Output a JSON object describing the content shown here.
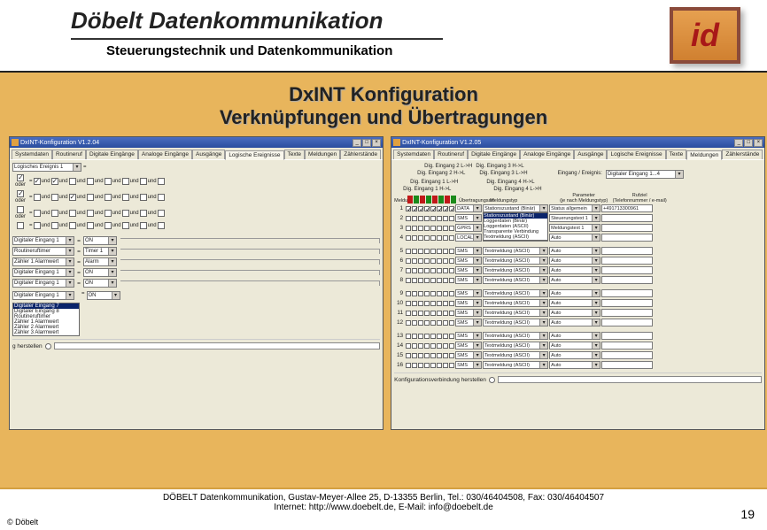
{
  "header": {
    "title": "Döbelt Datenkommunikation",
    "subtitle": "Steuerungstechnik und Datenkommunikation",
    "logo_text": "id"
  },
  "slide": {
    "line1": "DxINT Konfiguration",
    "line2": "Verknüpfungen und Übertragungen"
  },
  "win_left": {
    "title": "DxINT-Konfiguration V1.2.04",
    "tabs": [
      "Systemdaten",
      "Routineruf",
      "Digitale Eingänge",
      "Analoge Eingänge",
      "Ausgänge",
      "Logische Ereignisse",
      "Texte",
      "Meldungen",
      "Zählerstände"
    ],
    "active_tab": 5,
    "event_dd": "Logisches Ereignis 1",
    "und": "und",
    "oder": "oder",
    "eq": "=",
    "input_rows": [
      {
        "a": "Digitaler Eingang 1",
        "b": "ON"
      },
      {
        "a": "Routineruftimer",
        "b": "Timer 1"
      },
      {
        "a": "Zähler 1 Alarmwert",
        "b": "Alarm"
      },
      {
        "a": "Digitaler Eingang 1",
        "b": "ON"
      },
      {
        "a": "Digitaler Eingang 1",
        "b": "ON"
      }
    ],
    "extra_dd": "Digitaler Eingang 1",
    "listbox": [
      "Digitaler Eingang 7",
      "Digitaler Eingang 8",
      "Routineruftimer",
      "Zähler 1 Alarmwert",
      "Zähler 2 Alarmwert",
      "Zähler 3 Alarmwert"
    ],
    "last_dd": "ON",
    "status_label": "g herstellen"
  },
  "win_right": {
    "title": "DxINT-Konfiguration V1.2.05",
    "tabs": [
      "Systemdaten",
      "Routineruf",
      "Digitale Eingänge",
      "Analoge Eingänge",
      "Ausgänge",
      "Logische Ereignisse",
      "Texte",
      "Meldungen",
      "Zählerstände"
    ],
    "active_tab": 7,
    "hdr": {
      "l1a": "Dig. Eingang 2 L->H",
      "l1b": "Dig. Eingang 3 H->L",
      "l2a": "Dig. Eingang 2 H->L",
      "l2b": "Dig. Eingang 3 L->H",
      "l2c": "Eingang / Ereignis:",
      "l2d": "Digitaler Eingang 1...4",
      "l3a": "Dig. Eingang 1 L->H",
      "l3b": "Dig. Eingang 4 H->L",
      "l4a": "Dig. Eingang 1 H->L",
      "l4b": "Dig. Eingang 4 L->H"
    },
    "cols": {
      "meldung": "Meldung",
      "uart": "Übertragungsart",
      "mtyp": "Meldungstyp",
      "param": "Parameter\n(je nach Meldungstyp)",
      "rziel": "Rufziel\n(Telefonnummer / e-mail)"
    },
    "mtyp_list": [
      "Stationszustand (Binär)",
      "Loggerdaten (Binär)",
      "Loggerdaten (ASCII)",
      "Transparente Verbindung",
      "Textmeldung (ASCII)"
    ],
    "rows": [
      {
        "n": 1,
        "u": "DATA",
        "m": "Stationszustand (Binär)",
        "p": "Status allgemein",
        "r": "+491713300961",
        "chk": [
          1,
          1,
          1,
          1,
          1,
          1,
          1,
          1
        ]
      },
      {
        "n": 2,
        "u": "SMS",
        "m": "Loggerdaten (Binär)",
        "p": "Steuerungstext 1",
        "r": "",
        "chk": [
          0,
          0,
          0,
          0,
          0,
          0,
          0,
          0
        ]
      },
      {
        "n": 3,
        "u": "GPRS",
        "m": "Loggerdaten (ASCII)",
        "p": "Meldungstext 1",
        "r": "",
        "chk": [
          0,
          0,
          0,
          0,
          0,
          0,
          0,
          0
        ]
      },
      {
        "n": 4,
        "u": "LOCAL",
        "m": "Textmeldung (ASCII)",
        "p": "Auto",
        "r": "",
        "chk": [
          0,
          0,
          0,
          0,
          0,
          0,
          0,
          0
        ]
      },
      {
        "n": 5,
        "u": "SMS",
        "m": "Textmeldung (ASCII)",
        "p": "Auto",
        "r": "",
        "chk": [
          0,
          0,
          0,
          0,
          0,
          0,
          0,
          0
        ]
      },
      {
        "n": 6,
        "u": "SMS",
        "m": "Textmeldung (ASCII)",
        "p": "Auto",
        "r": "",
        "chk": [
          0,
          0,
          0,
          0,
          0,
          0,
          0,
          0
        ]
      },
      {
        "n": 7,
        "u": "SMS",
        "m": "Textmeldung (ASCII)",
        "p": "Auto",
        "r": "",
        "chk": [
          0,
          0,
          0,
          0,
          0,
          0,
          0,
          0
        ]
      },
      {
        "n": 8,
        "u": "SMS",
        "m": "Textmeldung (ASCII)",
        "p": "Auto",
        "r": "",
        "chk": [
          0,
          0,
          0,
          0,
          0,
          0,
          0,
          0
        ]
      },
      {
        "n": 9,
        "u": "SMS",
        "m": "Textmeldung (ASCII)",
        "p": "Auto",
        "r": "",
        "chk": [
          0,
          0,
          0,
          0,
          0,
          0,
          0,
          0
        ]
      },
      {
        "n": 10,
        "u": "SMS",
        "m": "Textmeldung (ASCII)",
        "p": "Auto",
        "r": "",
        "chk": [
          0,
          0,
          0,
          0,
          0,
          0,
          0,
          0
        ]
      },
      {
        "n": 11,
        "u": "SMS",
        "m": "Textmeldung (ASCII)",
        "p": "Auto",
        "r": "",
        "chk": [
          0,
          0,
          0,
          0,
          0,
          0,
          0,
          0
        ]
      },
      {
        "n": 12,
        "u": "SMS",
        "m": "Textmeldung (ASCII)",
        "p": "Auto",
        "r": "",
        "chk": [
          0,
          0,
          0,
          0,
          0,
          0,
          0,
          0
        ]
      },
      {
        "n": 13,
        "u": "SMS",
        "m": "Textmeldung (ASCII)",
        "p": "Auto",
        "r": "",
        "chk": [
          0,
          0,
          0,
          0,
          0,
          0,
          0,
          0
        ]
      },
      {
        "n": 14,
        "u": "SMS",
        "m": "Textmeldung (ASCII)",
        "p": "Auto",
        "r": "",
        "chk": [
          0,
          0,
          0,
          0,
          0,
          0,
          0,
          0
        ]
      },
      {
        "n": 15,
        "u": "SMS",
        "m": "Textmeldung (ASCII)",
        "p": "Auto",
        "r": "",
        "chk": [
          0,
          0,
          0,
          0,
          0,
          0,
          0,
          0
        ]
      },
      {
        "n": 16,
        "u": "SMS",
        "m": "Textmeldung (ASCII)",
        "p": "Auto",
        "r": "",
        "chk": [
          0,
          0,
          0,
          0,
          0,
          0,
          0,
          0
        ]
      }
    ],
    "status_label": "Konfigurationsverbindung herstellen"
  },
  "footer": {
    "line1": "DÖBELT Datenkommunikation, Gustav-Meyer-Allee 25, D-13355 Berlin, Tel.: 030/46404508, Fax: 030/46404507",
    "line2": "Internet: http://www.doebelt.de, E-Mail: info@doebelt.de",
    "copyright": "© Döbelt",
    "page": "19"
  }
}
